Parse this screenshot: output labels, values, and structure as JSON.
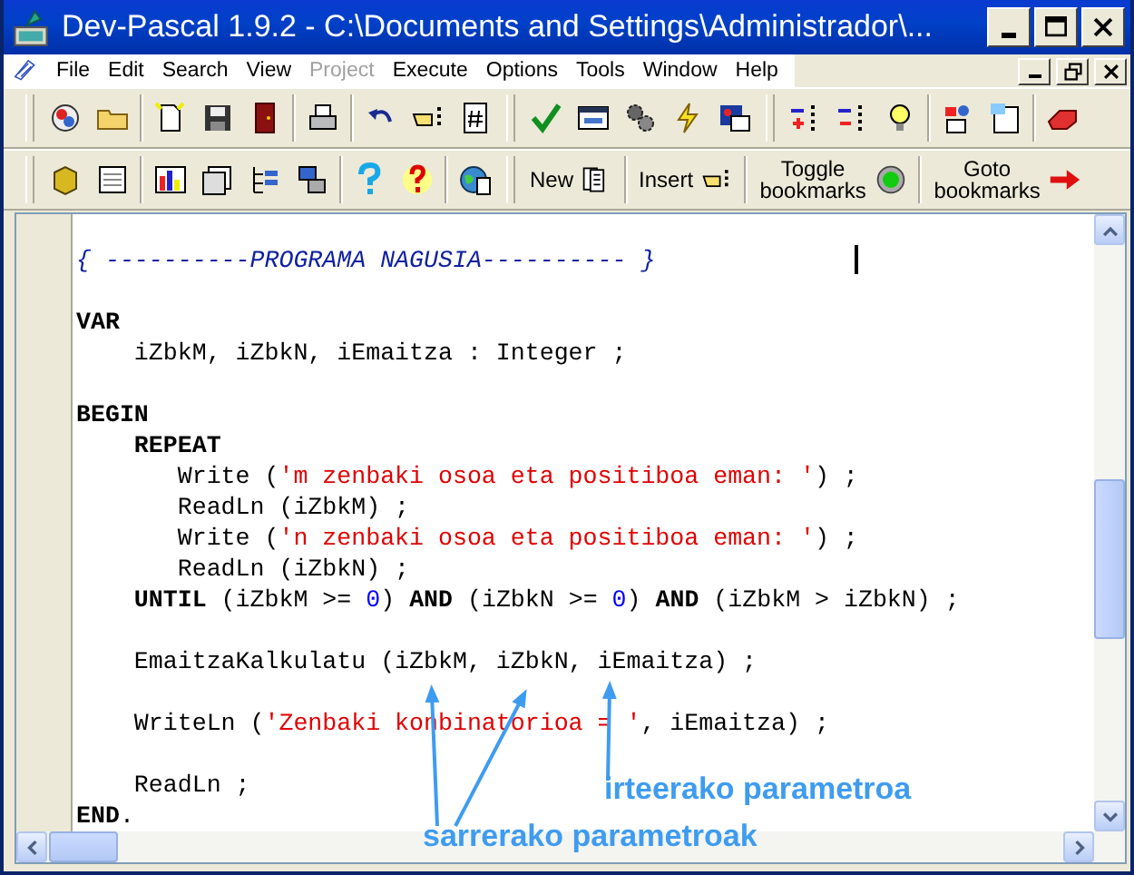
{
  "window": {
    "title": "Dev-Pascal 1.9.2 - C:\\Documents and Settings\\Administrador\\..."
  },
  "menu": [
    {
      "label": "File",
      "disabled": false
    },
    {
      "label": "Edit",
      "disabled": false
    },
    {
      "label": "Search",
      "disabled": false
    },
    {
      "label": "View",
      "disabled": false
    },
    {
      "label": "Project",
      "disabled": true
    },
    {
      "label": "Execute",
      "disabled": false
    },
    {
      "label": "Options",
      "disabled": false
    },
    {
      "label": "Tools",
      "disabled": false
    },
    {
      "label": "Window",
      "disabled": false
    },
    {
      "label": "Help",
      "disabled": false
    }
  ],
  "text_buttons": [
    {
      "label": "New"
    },
    {
      "label": "Insert"
    },
    {
      "label": "Toggle bookmarks"
    },
    {
      "label": "Goto bookmarks"
    }
  ],
  "code": [
    {
      "tokens": [
        {
          "kind": "comment",
          "text": "{ ----------PROGRAMA NAGUSIA---------- }"
        }
      ]
    },
    {
      "tokens": [
        {
          "kind": "keyword",
          "text": "VAR"
        }
      ]
    },
    {
      "tokens": [
        {
          "kind": "plain",
          "text": "    iZbkM, iZbkN, iEmaitza : Integer ;"
        }
      ]
    },
    {
      "tokens": [
        {
          "kind": "keyword",
          "text": "BEGIN"
        }
      ]
    },
    {
      "tokens": [
        {
          "kind": "keyword",
          "text": "    REPEAT"
        }
      ]
    },
    {
      "tokens": [
        {
          "kind": "plain",
          "text": "       Write ("
        },
        {
          "kind": "string",
          "text": "'m zenbaki osoa eta positiboa eman: '"
        },
        {
          "kind": "plain",
          "text": ") ;"
        }
      ]
    },
    {
      "tokens": [
        {
          "kind": "plain",
          "text": "       ReadLn (iZbkM) ;"
        }
      ]
    },
    {
      "tokens": [
        {
          "kind": "plain",
          "text": "       Write ("
        },
        {
          "kind": "string",
          "text": "'n zenbaki osoa eta positiboa eman: '"
        },
        {
          "kind": "plain",
          "text": ") ;"
        }
      ]
    },
    {
      "tokens": [
        {
          "kind": "plain",
          "text": "       ReadLn (iZbkN) ;"
        }
      ]
    },
    {
      "tokens": [
        {
          "kind": "keyword",
          "text": "    UNTIL"
        },
        {
          "kind": "plain",
          "text": " (iZbkM >= "
        },
        {
          "kind": "number",
          "text": "0"
        },
        {
          "kind": "plain",
          "text": ") "
        },
        {
          "kind": "keyword",
          "text": "AND"
        },
        {
          "kind": "plain",
          "text": " (iZbkN >= "
        },
        {
          "kind": "number",
          "text": "0"
        },
        {
          "kind": "plain",
          "text": ") "
        },
        {
          "kind": "keyword",
          "text": "AND"
        },
        {
          "kind": "plain",
          "text": " (iZbkM > iZbkN) ;"
        }
      ]
    },
    {
      "tokens": [
        {
          "kind": "plain",
          "text": "    EmaitzaKalkulatu (iZbkM, iZbkN, iEmaitza) ;"
        }
      ]
    },
    {
      "tokens": [
        {
          "kind": "plain",
          "text": "    WriteLn ("
        },
        {
          "kind": "string",
          "text": "'Zenbaki konbinatorioa = '"
        },
        {
          "kind": "plain",
          "text": ", iEmaitza) ;"
        }
      ]
    },
    {
      "tokens": [
        {
          "kind": "plain",
          "text": "    ReadLn ;"
        }
      ]
    },
    {
      "tokens": [
        {
          "kind": "keyword",
          "text": "END"
        },
        {
          "kind": "plain",
          "text": "."
        }
      ]
    }
  ],
  "annotations": [
    {
      "text": "irteerako parametroa"
    },
    {
      "text": "sarrerako parametroak"
    }
  ]
}
